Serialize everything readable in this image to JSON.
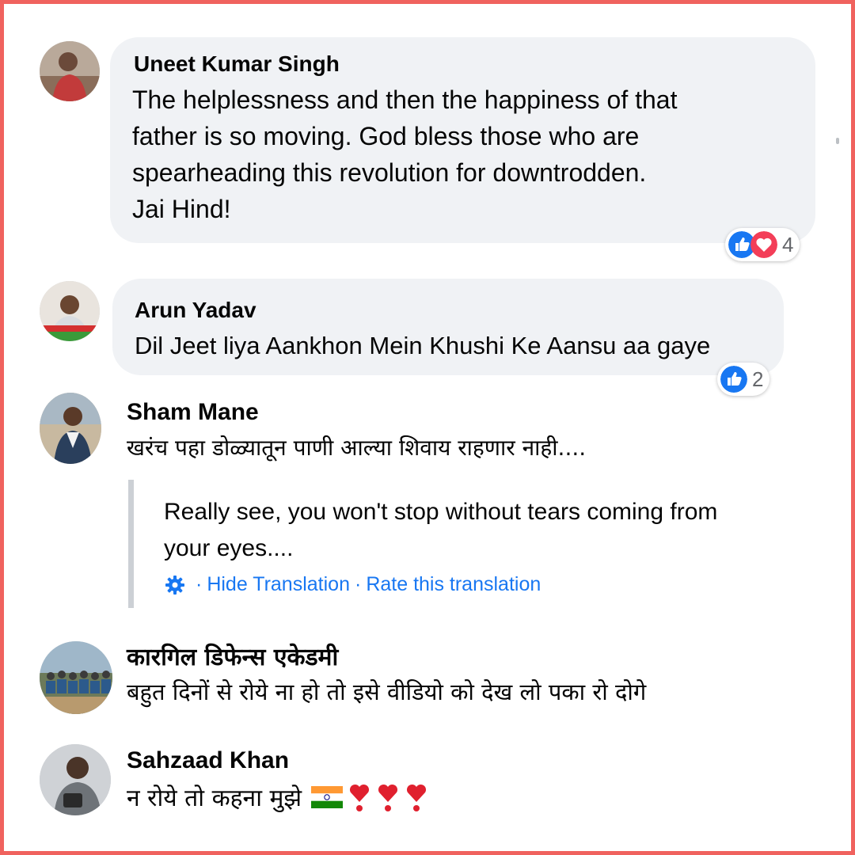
{
  "comments": [
    {
      "author": "Uneet Kumar Singh",
      "lines": [
        "The helplessness and then the happiness of that",
        "father is so moving. God bless those who are",
        "spearheading this revolution for downtrodden.",
        "Jai Hind!"
      ],
      "reactions": {
        "icons": [
          "like-icon",
          "love-icon"
        ],
        "count": "4"
      }
    },
    {
      "author": "Arun Yadav",
      "lines": [
        "Dil Jeet liya Aankhon Mein Khushi Ke Aansu aa gaye"
      ],
      "reactions": {
        "icons": [
          "like-icon"
        ],
        "count": "2"
      }
    },
    {
      "author": "Sham Mane",
      "lines": [
        "खरंच पहा डोळ्यातून पाणी आल्या शिवाय राहणार नाही...."
      ],
      "translation": {
        "lines": [
          "Really see, you won't stop without tears coming from",
          "your eyes...."
        ],
        "hide_label": "Hide Translation",
        "separator": "·",
        "rate_label": "Rate this translation"
      }
    },
    {
      "author": "कारगिल डिफेन्स एकेडमी",
      "lines": [
        "बहुत दिनों से रोये ना हो तो इसे वीडियो को देख लो पका रो दोगे"
      ]
    },
    {
      "author": "Sahzaad Khan",
      "lines": [
        "न रोये तो कहना मुझे"
      ],
      "emoji": [
        "india-flag-icon",
        "heart-exclamation-icon",
        "heart-exclamation-icon",
        "heart-exclamation-icon"
      ]
    }
  ],
  "colors": {
    "border": "#f0625e",
    "bubble": "#f0f2f5",
    "link": "#1877f2",
    "like": "#1877f2",
    "love": "#f33e58",
    "muted": "#65676b"
  }
}
